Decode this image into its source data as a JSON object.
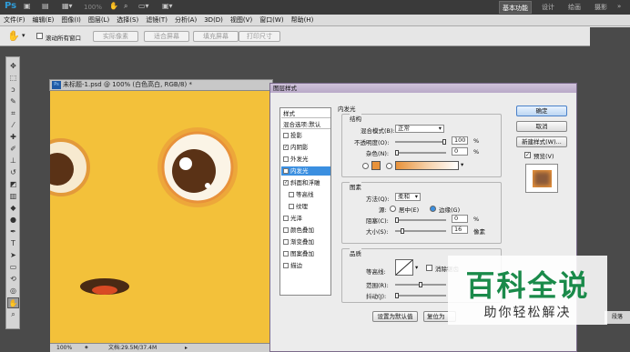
{
  "app": {
    "logo": "Ps",
    "zoom": "100%"
  },
  "workspaces": [
    "基本功能",
    "设计",
    "绘画",
    "摄影"
  ],
  "menu": [
    "文件(F)",
    "编辑(E)",
    "图像(I)",
    "图层(L)",
    "选择(S)",
    "滤镜(T)",
    "分析(A)",
    "3D(D)",
    "视图(V)",
    "窗口(W)",
    "帮助(H)"
  ],
  "options": {
    "scroll_all": "滚动所有窗口",
    "actual_pixels": "实际像素",
    "fit_screen": "适合屏幕",
    "fill_screen": "填充屏幕",
    "print_size": "打印尺寸"
  },
  "document": {
    "tab_title": "未标题-1.psd @ 100% (白色高白, RGB/8) *",
    "zoom": "100%",
    "file_info": "文档:29.5M/37.4M"
  },
  "dialog": {
    "title": "图层样式",
    "styles_header": "样式",
    "blend_default": "混合选项:默认",
    "items": [
      {
        "label": "投影",
        "checked": false,
        "sub": false,
        "selected": false
      },
      {
        "label": "内阴影",
        "checked": true,
        "sub": false,
        "selected": false
      },
      {
        "label": "外发光",
        "checked": false,
        "sub": false,
        "selected": false
      },
      {
        "label": "内发光",
        "checked": true,
        "sub": false,
        "selected": true
      },
      {
        "label": "斜面和浮雕",
        "checked": true,
        "sub": false,
        "selected": false
      },
      {
        "label": "等高线",
        "checked": false,
        "sub": true,
        "selected": false
      },
      {
        "label": "纹理",
        "checked": false,
        "sub": true,
        "selected": false
      },
      {
        "label": "光泽",
        "checked": false,
        "sub": false,
        "selected": false
      },
      {
        "label": "颜色叠加",
        "checked": false,
        "sub": false,
        "selected": false
      },
      {
        "label": "渐变叠加",
        "checked": false,
        "sub": false,
        "selected": false
      },
      {
        "label": "图案叠加",
        "checked": false,
        "sub": false,
        "selected": false
      },
      {
        "label": "描边",
        "checked": false,
        "sub": false,
        "selected": false
      }
    ],
    "section": "内发光",
    "structure": {
      "title": "结构",
      "blend_mode_label": "混合模式(B):",
      "blend_mode": "正常",
      "opacity_label": "不透明度(O):",
      "opacity": "100",
      "noise_label": "杂色(N):",
      "noise": "0",
      "percent": "%"
    },
    "elements": {
      "title": "图素",
      "method_label": "方法(Q):",
      "method": "柔和",
      "source_label": "源:",
      "center": "居中(E)",
      "edge": "边缘(G)",
      "choke_label": "阻塞(C):",
      "choke": "0",
      "size_label": "大小(S):",
      "size": "16",
      "px": "像素"
    },
    "quality": {
      "title": "品质",
      "contour_label": "等高线:",
      "antialias": "消除锯齿",
      "range_label": "范围(R):",
      "jitter_label": "抖动(J):"
    },
    "buttons": {
      "ok": "确定",
      "cancel": "取消",
      "new_style": "新建样式(W)...",
      "preview": "预览(V)",
      "make_default": "设置为默认值",
      "reset_default": "复位为"
    }
  },
  "watermark": {
    "main": "百科全说",
    "sub": "助你轻松解决"
  },
  "panel_tab": "段落",
  "colors": {
    "canvas": "#f3c13a",
    "glow": "#e8923a",
    "eye": "#5a3216",
    "mouth": "#d84a24",
    "watermark": "#1a8a4a"
  }
}
